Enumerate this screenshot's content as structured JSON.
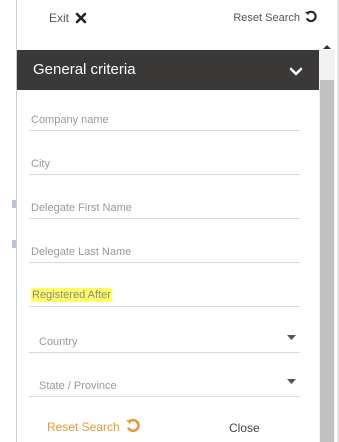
{
  "topbar": {
    "exit_label": "Exit",
    "reset_label": "Reset Search"
  },
  "section": {
    "title": "General criteria"
  },
  "fields": [
    {
      "placeholder": "Company name"
    },
    {
      "placeholder": "City"
    },
    {
      "placeholder": "Delegate First Name"
    },
    {
      "placeholder": "Delegate Last Name"
    },
    {
      "placeholder": "Registered After"
    }
  ],
  "selects": [
    {
      "label": "Country"
    },
    {
      "label": "State / Province"
    }
  ],
  "footer": {
    "reset_label": "Reset Search",
    "close_label": "Close"
  },
  "colors": {
    "header_bg": "#3b3838",
    "accent_orange": "#e39b39",
    "highlight": "#ffff66"
  }
}
